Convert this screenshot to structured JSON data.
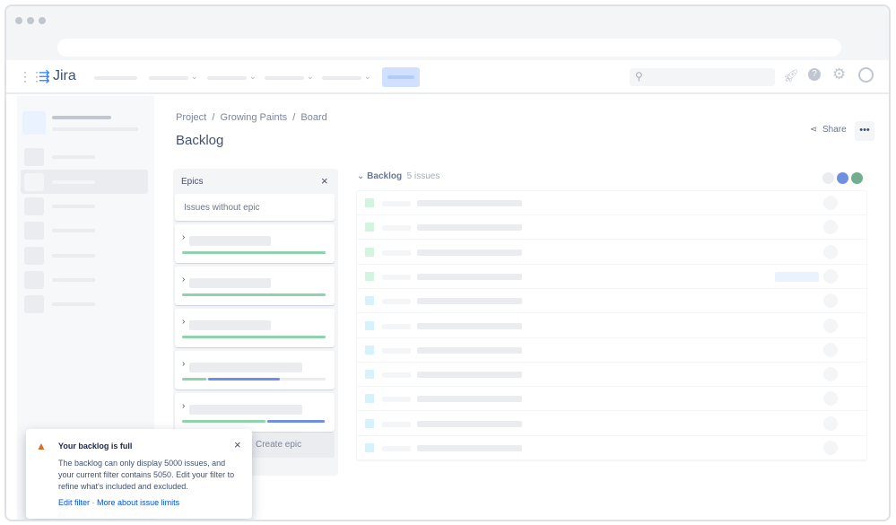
{
  "app": {
    "logo": "Jira"
  },
  "breadcrumb": [
    "Project",
    "Growing Paints",
    "Board"
  ],
  "page_title": "Backlog",
  "actions": {
    "share": "Share",
    "more_icon": "ellipsis-icon"
  },
  "epics": {
    "title": "Epics",
    "without_epic": "Issues without epic",
    "create": "Create epic",
    "items": [
      {
        "done": 1,
        "in_progress": 0
      },
      {
        "done": 1,
        "in_progress": 0
      },
      {
        "done": 1,
        "in_progress": 0
      },
      {
        "done": 0.17,
        "in_progress": 0.5
      },
      {
        "done": 0.58,
        "in_progress": 0.4
      }
    ]
  },
  "backlog": {
    "title": "Backlog",
    "count": "5 issues",
    "rows": [
      "story",
      "story",
      "story",
      "story",
      "task",
      "task",
      "task",
      "task",
      "task",
      "task",
      "task"
    ]
  },
  "toast": {
    "title": "Your backlog is full",
    "body": "The backlog can only display 5000 issues, and your current filter contains 5050. Edit your filter to refine what's included and excluded.",
    "link1": "Edit filter",
    "sep": "·",
    "link2": "More about issue limits"
  },
  "colors": {
    "accent": "#0052cc",
    "done": "#57d9a3",
    "progress": "#4c9aff",
    "warning": "#de6b28"
  }
}
